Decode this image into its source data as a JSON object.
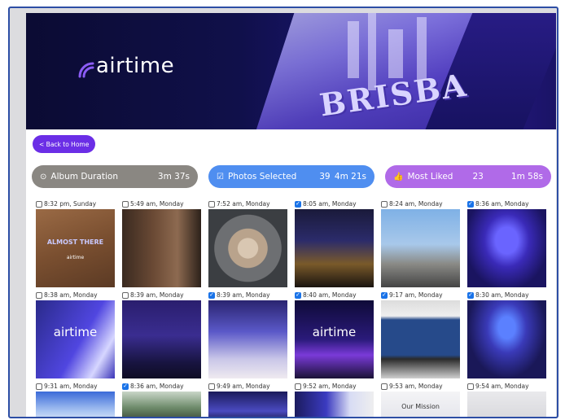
{
  "brand": {
    "name": "airtime"
  },
  "banner": {
    "city_text": "BRISBA"
  },
  "nav": {
    "back_label": "< Back to Home"
  },
  "stats": {
    "duration": {
      "label": "Album Duration",
      "value": "3m 37s"
    },
    "selected": {
      "label": "Photos Selected",
      "count": "39",
      "time": "4m 21s"
    },
    "liked": {
      "label": "Most Liked",
      "count": "23",
      "time": "1m 58s"
    }
  },
  "colors": {
    "accent": "#6b2ee6",
    "duration_bar": "#8a8782",
    "selected_bar": "#4f8ef0",
    "liked_bar": "#b06ae8",
    "check_blue": "#1a73e8"
  },
  "photos": [
    {
      "time": "8:32 pm, Sunday",
      "checked": false,
      "overlay": "ALMOST THERE",
      "overlay2": "airtime"
    },
    {
      "time": "5:49 am, Monday",
      "checked": false
    },
    {
      "time": "7:52 am, Monday",
      "checked": false
    },
    {
      "time": "8:05 am, Monday",
      "checked": true
    },
    {
      "time": "8:24 am, Monday",
      "checked": false
    },
    {
      "time": "8:36 am, Monday",
      "checked": true
    },
    {
      "time": "8:38 am, Monday",
      "checked": false,
      "overlay": "airtime"
    },
    {
      "time": "8:39 am, Monday",
      "checked": false
    },
    {
      "time": "8:39 am, Monday",
      "checked": true
    },
    {
      "time": "8:40 am, Monday",
      "checked": true,
      "overlay": "airtime"
    },
    {
      "time": "9:17 am, Monday",
      "checked": true
    },
    {
      "time": "8:30 am, Monday",
      "checked": true
    },
    {
      "time": "9:31 am, Monday",
      "checked": false
    },
    {
      "time": "8:36 am, Monday",
      "checked": true
    },
    {
      "time": "9:49 am, Monday",
      "checked": false
    },
    {
      "time": "9:52 am, Monday",
      "checked": false
    },
    {
      "time": "9:53 am, Monday",
      "checked": false,
      "overlay": "Our Mission"
    },
    {
      "time": "9:54 am, Monday",
      "checked": false
    }
  ]
}
